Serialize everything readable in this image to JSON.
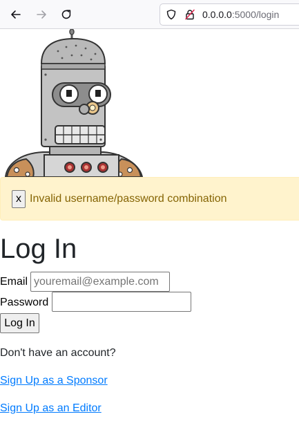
{
  "browser": {
    "url_host": "0.0.0.0",
    "url_rest": ":5000/login"
  },
  "icons": {
    "back": "arrow-left-icon",
    "forward": "arrow-right-icon",
    "reload": "reload-icon",
    "tracking_protection": "shield-icon",
    "connection": "insecure-lock-icon",
    "mascot": "robot-image"
  },
  "alert": {
    "close_label": "x",
    "message": "Invalid username/password combination"
  },
  "login": {
    "title": "Log In",
    "email_label": "Email",
    "email_placeholder": "youremail@example.com",
    "email_value": "",
    "password_label": "Password",
    "password_value": "",
    "submit_label": "Log In"
  },
  "signup": {
    "prompt": "Don't have an account?",
    "sponsor_link": "Sign Up as a Sponsor",
    "editor_link": "Sign Up as an Editor"
  },
  "colors": {
    "alert_background": "#fff3cd",
    "alert_text": "#856404",
    "link": "#007bff"
  }
}
